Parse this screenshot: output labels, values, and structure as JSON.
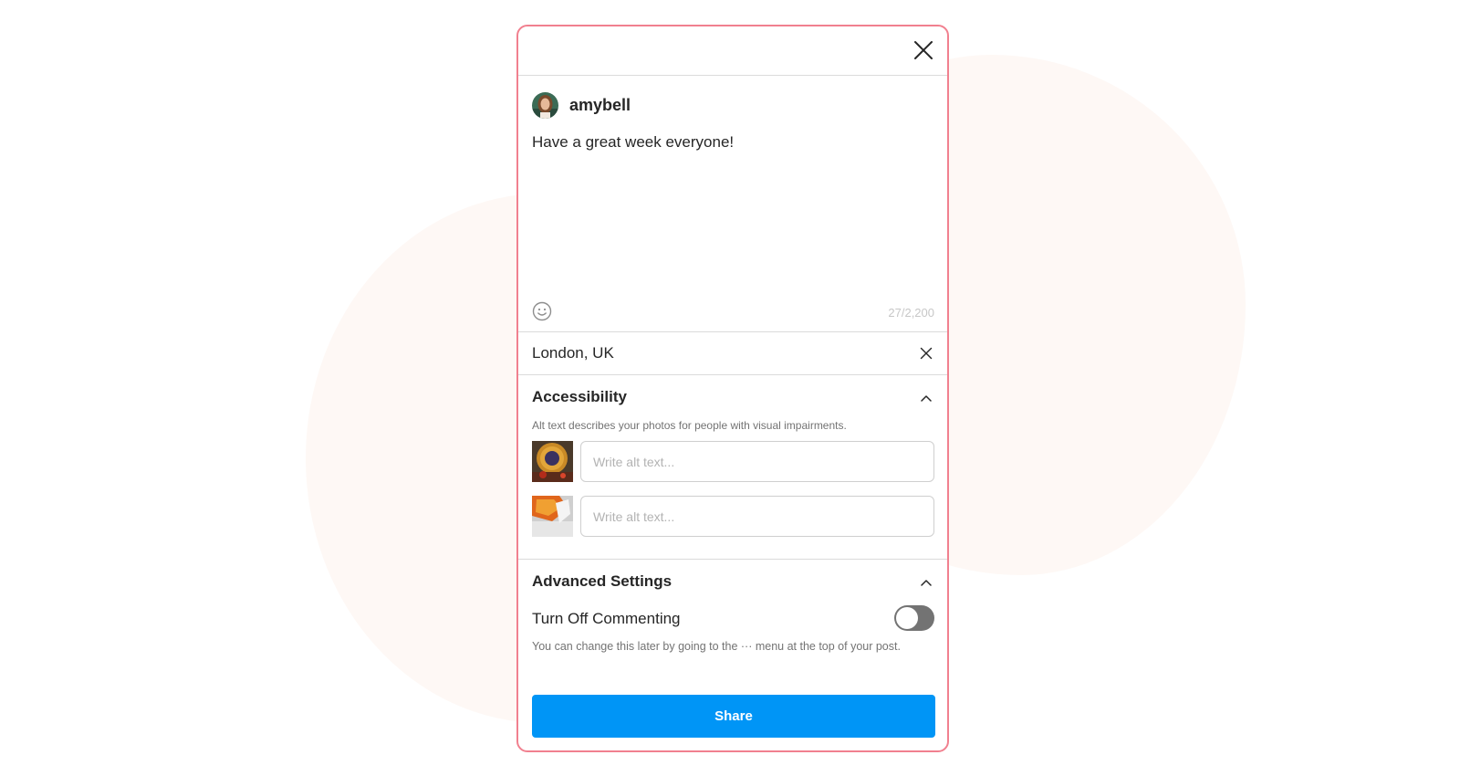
{
  "post": {
    "username": "amybell",
    "caption": "Have a great week everyone!",
    "char_count": "27/2,200"
  },
  "location": {
    "value": "London, UK"
  },
  "accessibility": {
    "title": "Accessibility",
    "description": "Alt text describes your photos for people with visual impairments.",
    "alt_inputs": [
      {
        "placeholder": "Write alt text...",
        "value": ""
      },
      {
        "placeholder": "Write alt text...",
        "value": ""
      }
    ]
  },
  "advanced": {
    "title": "Advanced Settings",
    "toggle_label": "Turn Off Commenting",
    "toggle_on": false,
    "note": "You can change this later by going to the ··· menu at the top of your post."
  },
  "share_label": "Share",
  "colors": {
    "accent": "#0095f6",
    "modal_border": "#f1808f",
    "toggle_off": "#737373",
    "backdrop_blob": "#fef8f5"
  },
  "icons": [
    "close-icon",
    "emoji-icon",
    "clear-location-icon",
    "chevron-up-icon"
  ]
}
